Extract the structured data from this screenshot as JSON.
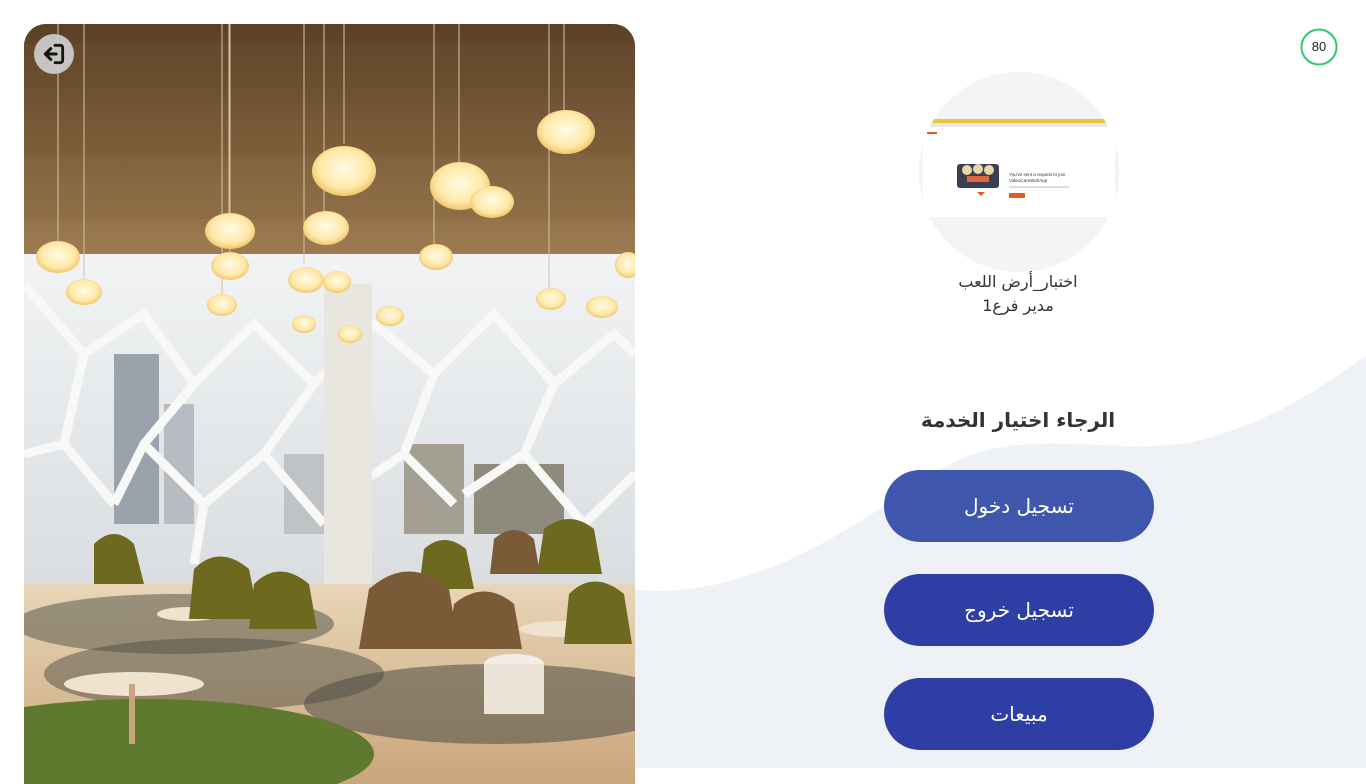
{
  "timer": {
    "value": "80",
    "progress": 1.0,
    "color": "#2ecc71"
  },
  "logout": {
    "icon": "logout-arrow-icon"
  },
  "profile": {
    "name": "اختبار_أرض اللعب",
    "role": "مدير فرع1",
    "avatar": {
      "title_line1": "You've sent a request to join",
      "title_line2": "VideoCareWebApp"
    }
  },
  "prompt": "الرجاء اختيار الخدمة",
  "services": [
    {
      "label": "تسجيل دخول",
      "color": "#3e57ad"
    },
    {
      "label": "تسجيل خروج",
      "color": "#2e3ea4"
    },
    {
      "label": "مبيعات",
      "color": "#2e3ea4"
    }
  ],
  "colors": {
    "wave": "#eef1f6",
    "panel_bg": "#ffffff"
  }
}
